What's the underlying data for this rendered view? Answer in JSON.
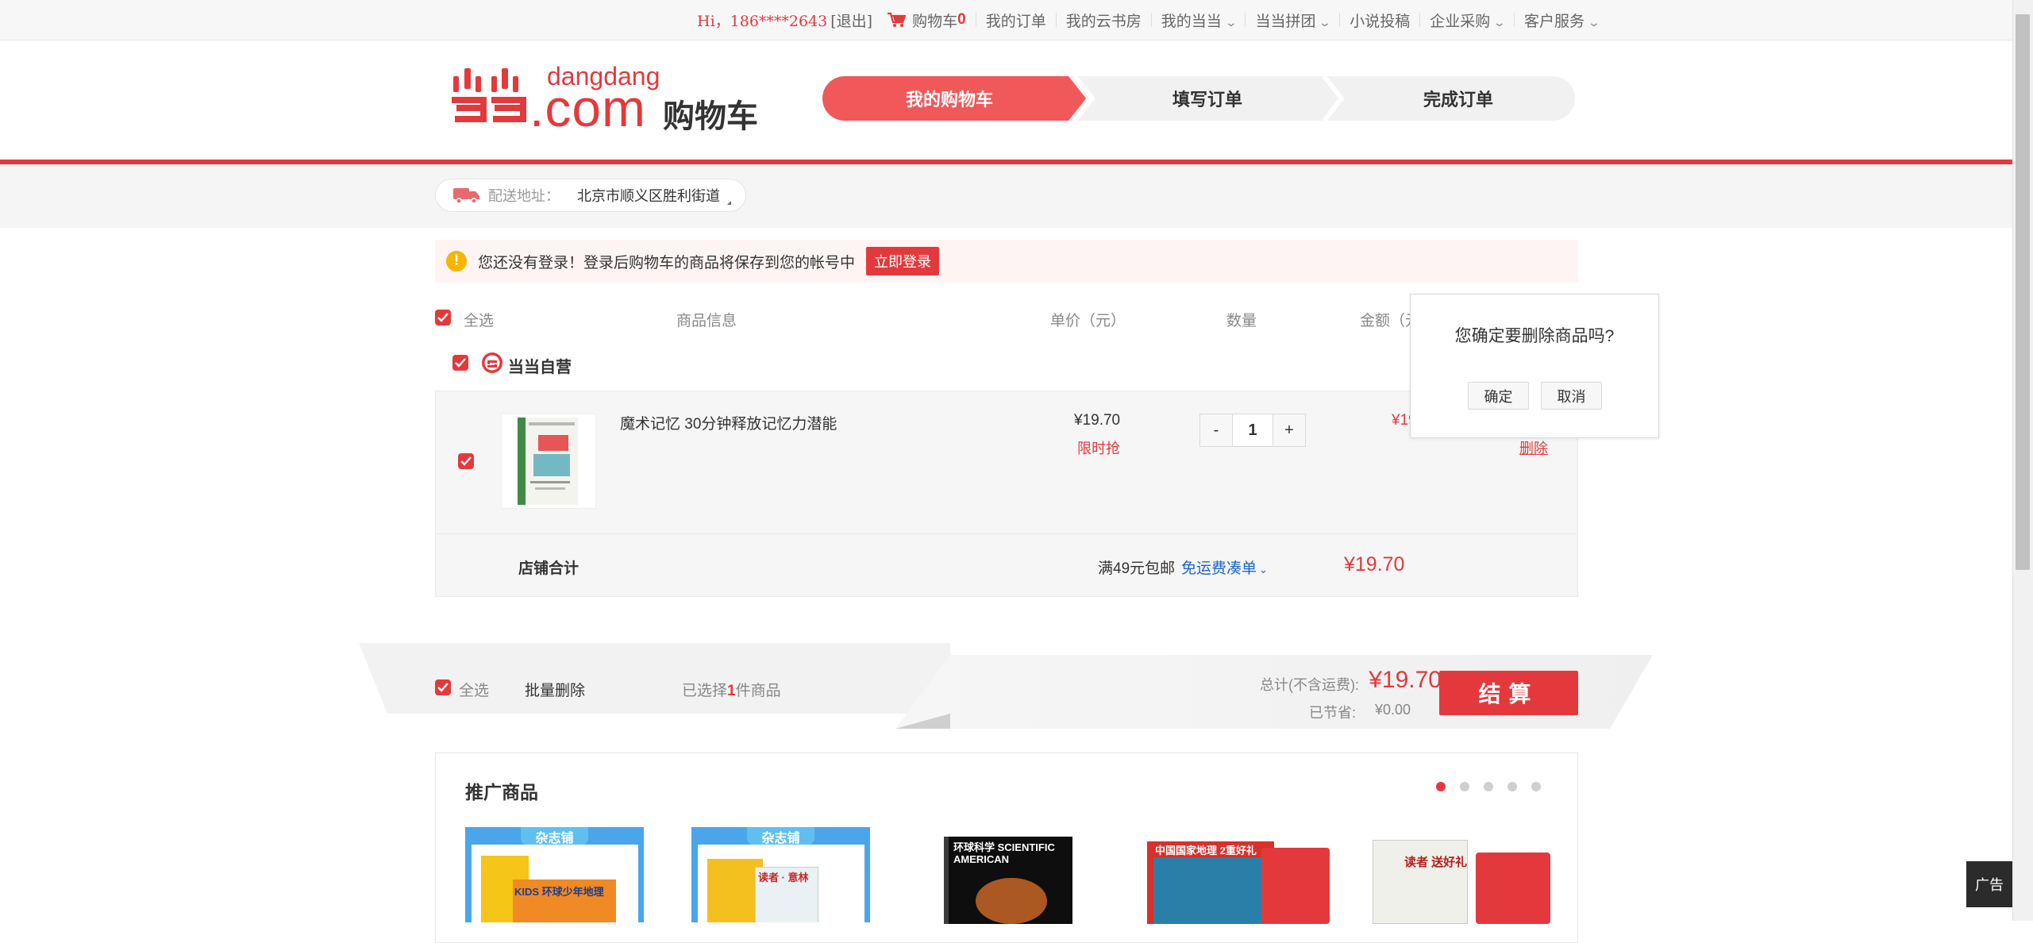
{
  "topnav": {
    "greeting": "Hi，186****2643",
    "logout": "[退出]",
    "cart_label": "购物车",
    "cart_count": "0",
    "my_orders": "我的订单",
    "cloud_bookroom": "我的云书房",
    "my_dangdang": "我的当当",
    "group_buy": "当当拼团",
    "novel_submit": "小说投稿",
    "enterprise": "企业采购",
    "customer_service": "客户服务"
  },
  "header": {
    "logo_word": "dangdang",
    "logo_com": ".com",
    "logo_title": "购物车",
    "steps": [
      "我的购物车",
      "填写订单",
      "完成订单"
    ]
  },
  "address": {
    "label": "配送地址：",
    "value": "北京市顺义区胜利街道"
  },
  "notice": {
    "text": "您还没有登录！登录后购物车的商品将保存到您的帐号中",
    "login_button": "立即登录"
  },
  "table": {
    "select_all": "全选",
    "col_info": "商品信息",
    "col_price": "单价（元）",
    "col_qty": "数量",
    "col_amount": "金额（元）"
  },
  "shop": {
    "name": "当当自营",
    "items": [
      {
        "title": "魔术记忆 30分钟释放记忆力潜能",
        "price": "¥19.70",
        "promo": "限时抢",
        "qty": "1",
        "minus": "-",
        "plus": "+",
        "amount": "¥19.70",
        "delete": "删除"
      }
    ],
    "total_label": "店铺合计",
    "shipping_text": "满49元包邮",
    "shipping_link": "免运费凑单",
    "total": "¥19.70"
  },
  "popup": {
    "message": "您确定要删除商品吗?",
    "confirm": "确定",
    "cancel": "取消"
  },
  "footer_bar": {
    "select_all": "全选",
    "batch_delete": "批量删除",
    "selected_prefix": "已选择",
    "selected_count": "1",
    "selected_suffix": "件商品",
    "total_label": "总计(不含运费):",
    "total": "¥19.70",
    "saved_label": "已节省:",
    "saved": "¥0.00",
    "checkout": "结算"
  },
  "promo": {
    "title": "推广商品",
    "ad_badge": "广告",
    "items": [
      {
        "tag": "杂志铺",
        "cover": "KIDS 环球少年地理"
      },
      {
        "tag": "杂志铺",
        "cover": "读者 · 意林"
      },
      {
        "tag": "",
        "cover": "环球科学 SCIENTIFIC AMERICAN"
      },
      {
        "tag": "",
        "cover": "中国国家地理 2重好礼"
      },
      {
        "tag": "",
        "cover": "读者 送好礼"
      }
    ],
    "page_count": 5,
    "active_page": 1
  },
  "colors": {
    "brand_red": "#e4393c",
    "step_active": "#f0585a",
    "link_blue": "#1a66c4"
  }
}
